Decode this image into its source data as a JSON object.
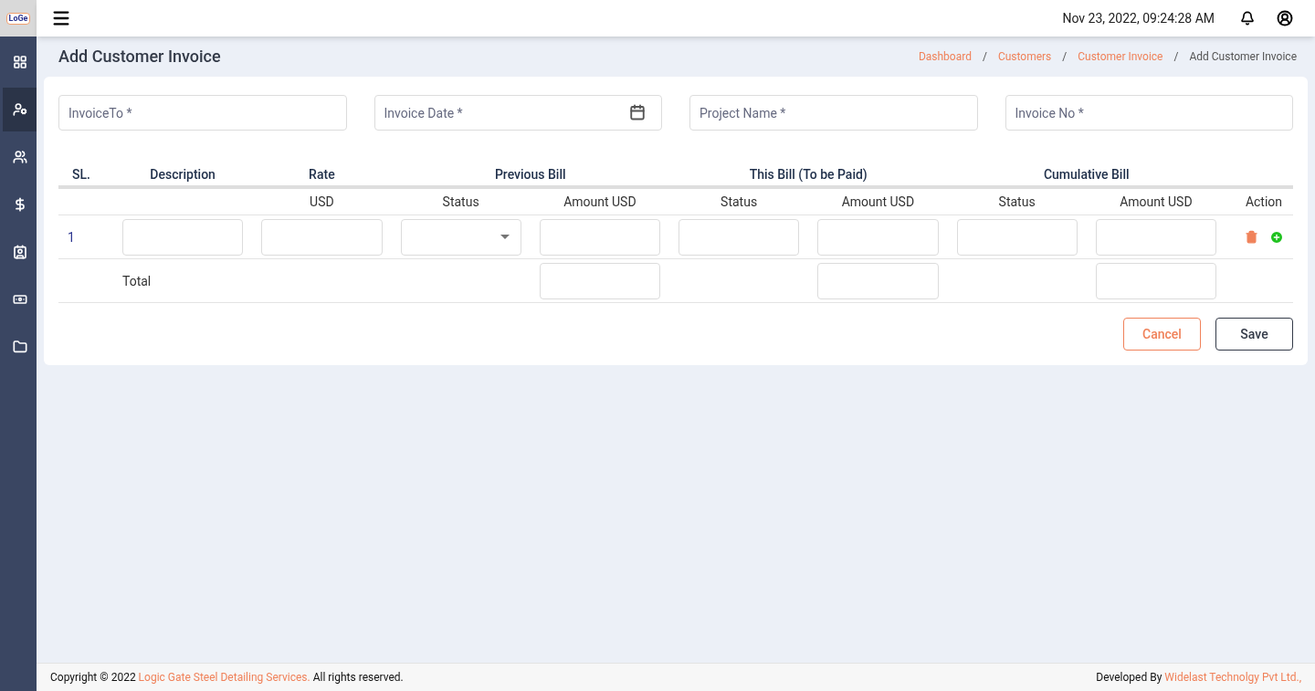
{
  "logo": {
    "text": "LoGe"
  },
  "topbar": {
    "datetime": "Nov 23, 2022, 09:24:28 AM"
  },
  "sidebar": {
    "items": [
      {
        "selected": false
      },
      {
        "selected": true
      },
      {
        "selected": false
      },
      {
        "selected": false
      },
      {
        "selected": false
      },
      {
        "selected": false
      },
      {
        "selected": false
      }
    ]
  },
  "page": {
    "title": "Add Customer Invoice",
    "breadcrumb": [
      {
        "label": "Dashboard",
        "kind": "link"
      },
      {
        "label": "/",
        "kind": "separator"
      },
      {
        "label": "Customers",
        "kind": "link"
      },
      {
        "label": "/",
        "kind": "separator"
      },
      {
        "label": "Customer Invoice",
        "kind": "link"
      },
      {
        "label": "/",
        "kind": "separator"
      },
      {
        "label": "Add Customer Invoice",
        "kind": "current"
      }
    ]
  },
  "form": {
    "fields": [
      {
        "placeholder": "InvoiceTo *",
        "kind": "text"
      },
      {
        "placeholder": "Invoice Date *",
        "kind": "date"
      },
      {
        "placeholder": "Project Name *",
        "kind": "text"
      },
      {
        "placeholder": "Invoice No *",
        "kind": "text"
      }
    ]
  },
  "table": {
    "group_headers": [
      "SL.",
      "Description",
      "Rate",
      "Previous Bill",
      "This Bill (To be Paid)",
      "Cumulative Bill"
    ],
    "columns": [
      "",
      "",
      "USD",
      "Status",
      "Amount USD",
      "Status",
      "Amount USD",
      "Status",
      "Amount USD",
      "Action"
    ],
    "rows": [
      {
        "sl": "1",
        "cells": [
          {
            "kind": "input"
          },
          {
            "kind": "input"
          },
          {
            "kind": "select"
          },
          {
            "kind": "input"
          },
          {
            "kind": "input"
          },
          {
            "kind": "input"
          },
          {
            "kind": "input"
          },
          {
            "kind": "input"
          }
        ]
      }
    ],
    "total": {
      "label": "Total",
      "cells": [
        {
          "kind": "empty"
        },
        {
          "kind": "empty"
        },
        {
          "kind": "input"
        },
        {
          "kind": "empty"
        },
        {
          "kind": "input"
        },
        {
          "kind": "empty"
        },
        {
          "kind": "input"
        }
      ]
    }
  },
  "buttons": [
    {
      "label": "Cancel",
      "kind": "secondary"
    },
    {
      "label": "Save",
      "kind": "primary"
    }
  ],
  "footer": {
    "left": {
      "before": "Copyright © 2022",
      "link": "Logic Gate Steel Detailing Services.",
      "after": "All rights reserved."
    },
    "right": {
      "before": "Developed By",
      "link": "Widelast Technolgy Pvt Ltd.,"
    }
  }
}
